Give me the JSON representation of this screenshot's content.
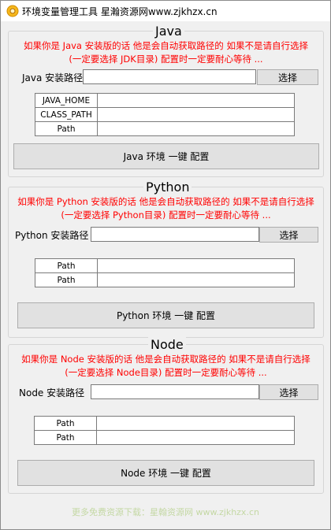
{
  "window": {
    "title": "环境变量管理工具 星瀚资源网www.zjkhzx.cn",
    "icon": "gear-app-icon"
  },
  "java": {
    "group_title": "Java",
    "warning_line1": "如果你是 Java 安装版的话 他是会自动获取路径的 如果不是请自行选择",
    "warning_line2": "(一定要选择 JDK目录) 配置时一定要耐心等待 ...",
    "path_label": "Java 安装路径",
    "path_value": "",
    "browse_label": "选择",
    "rows": [
      {
        "key": "JAVA_HOME",
        "value": ""
      },
      {
        "key": "CLASS_PATH",
        "value": ""
      },
      {
        "key": "Path",
        "value": ""
      }
    ],
    "configure_label": "Java 环境 一键 配置"
  },
  "python": {
    "group_title": "Python",
    "warning_line1": "如果你是 Python 安装版的话 他是会自动获取路径的 如果不是请自行选择",
    "warning_line2": "(一定要选择 Python目录) 配置时一定要耐心等待 ...",
    "path_label": "Python 安装路径",
    "path_value": "",
    "browse_label": "选择",
    "rows": [
      {
        "key": "Path",
        "value": ""
      },
      {
        "key": "Path",
        "value": ""
      }
    ],
    "configure_label": "Python 环境 一键 配置"
  },
  "node": {
    "group_title": "Node",
    "warning_line1": "如果你是 Node 安装版的话 他是会自动获取路径的 如果不是请自行选择",
    "warning_line2": "(一定要选择 Node目录) 配置时一定要耐心等待 ...",
    "path_label": "Node 安装路径",
    "path_value": "",
    "browse_label": "选择",
    "rows": [
      {
        "key": "Path",
        "value": ""
      },
      {
        "key": "Path",
        "value": ""
      }
    ],
    "configure_label": "Node 环境 一键 配置"
  },
  "footer": {
    "text": "更多免费资源下载：星翰资源网 www.zjkhzx.cn"
  },
  "colors": {
    "warning": "#ff0000",
    "footer": "#c4d8a4",
    "window_bg": "#f0f0f0"
  }
}
